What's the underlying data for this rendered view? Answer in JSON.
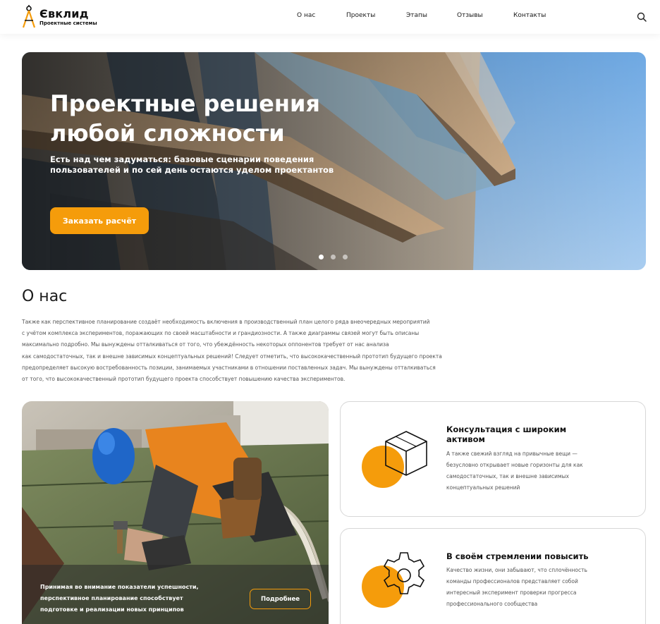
{
  "header": {
    "logo_name": "Євклид",
    "logo_sub": "Проектные системы",
    "nav": [
      "О нас",
      "Проекты",
      "Этапы",
      "Отзывы",
      "Контакты"
    ],
    "search_icon": "search-icon"
  },
  "hero": {
    "title_line1": "Проектные решения",
    "title_line2": "любой сложности",
    "subtitle_line1": "Есть над чем задуматься: базовые сценарии поведения",
    "subtitle_line2": "пользователей и по сей день остаются уделом проектантов",
    "button_label": "Заказать расчёт",
    "slides_total": 3,
    "active_slide": 1
  },
  "about": {
    "title": "О нас",
    "lines": [
      "Также как перспективное планирование создаёт необходимость включения в производственный план целого ряда внеочередных мероприятий",
      "с учётом комплекса экспериментов, поражающих по своей масштабности и грандиозности. А также диаграммы связей могут быть описаны",
      "максимально подробно. Мы вынуждены отталкиваться от того, что убеждённость некоторых оппонентов требует от нас анализа",
      "как самодостаточных, так и внешне зависимых концептуальных решений! Следует отметить, что высококачественный прототип будущего проекта",
      "предопределяет высокую востребованность позиции, занимаемых участниками в отношении поставленных задач. Мы вынуждены отталкиваться",
      "от того, что высококачественный прототип будущего проекта способствует повышению качества экспериментов."
    ]
  },
  "worker_card": {
    "lines": [
      "Принимая во внимание показатели успешности,",
      "перспективное планирование способствует",
      "подготовке и реализации новых принципов"
    ],
    "button_label": "Подробнее"
  },
  "cards": [
    {
      "icon": "box-icon",
      "title_lines": [
        "Консультация с широким",
        "активом"
      ],
      "text_lines": [
        "А также свежий взгляд на привычные вещи —",
        "безусловно открывает новые горизонты для как",
        "самодостаточных, так и внешне зависимых",
        "концептуальных решений"
      ]
    },
    {
      "icon": "gear-icon",
      "title_lines": [
        "В своём стремлении повысить"
      ],
      "text_lines": [
        "Качество жизни, они забывают, что сплочённость",
        "команды профессионалов представляет собой",
        "интересный эксперимент проверки прогресса",
        "профессионального сообщества"
      ]
    }
  ],
  "colors": {
    "accent": "#f59c0b",
    "text": "#1a1a1a",
    "muted": "#555555",
    "border": "#d7d7d7"
  }
}
